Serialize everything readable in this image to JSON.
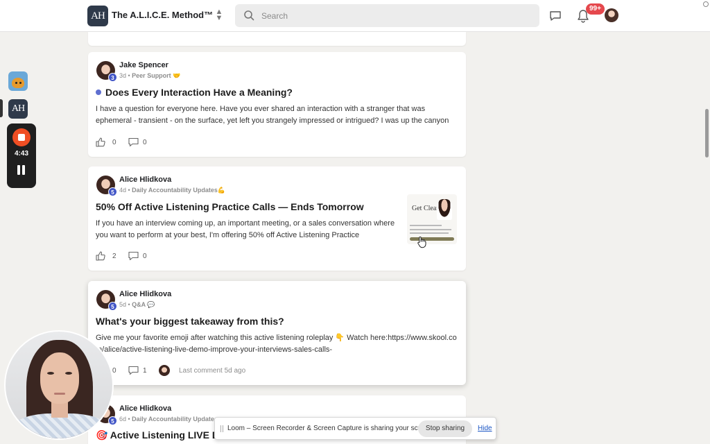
{
  "header": {
    "logo_text": "AH",
    "group_title": "The A.L.I.C.E. Method™",
    "search_placeholder": "Search",
    "notification_count": "99+"
  },
  "rail": {
    "app2_text": "AH",
    "recorder_time": "4:43"
  },
  "posts": [
    {
      "author": "Jake Spencer",
      "level": "3",
      "age": "3d",
      "category": "Peer Support 🤝",
      "title": "Does Every Interaction Have a Meaning?",
      "body": "I have a question for everyone here. Have you ever shared an interaction with a stranger that was ephemeral - transient - on the surface, yet left you strangely impressed or intrigued? I was up the canyon",
      "likes": "0",
      "comments": "0"
    },
    {
      "author": "Alice Hlidkova",
      "level": "5",
      "age": "4d",
      "category": "Daily Accountability Updates💪",
      "title": "50% Off Active Listening Practice Calls — Ends Tomorrow",
      "body": "If you have an interview coming up, an important meeting, or a sales conversation where you want to perform at your best, I'm offering 50% off Active Listening Practice",
      "likes": "2",
      "comments": "0",
      "thumb_headline": "Get Clear"
    },
    {
      "author": "Alice Hlidkova",
      "level": "5",
      "age": "5d",
      "category": "Q&A 💬",
      "title": "What's your biggest takeaway from this?",
      "body": "Give me your favorite emoji after watching this active listening roleplay 👇 Watch here:https://www.skool.com/alice/active-listening-live-demo-improve-your-interviews-sales-calls-",
      "likes": "0",
      "comments": "1",
      "last_comment": "Last comment 5d ago"
    },
    {
      "author": "Alice Hlidkova",
      "level": "5",
      "age": "6d",
      "category": "Daily Accountability Updates",
      "title": "🎯 Active Listening LIVE De"
    }
  ],
  "loom": {
    "message": "Loom – Screen Recorder & Screen Capture is sharing your screen.",
    "stop_label": "Stop sharing",
    "hide_label": "Hide"
  },
  "colors": {
    "level_badge": "#4256c7",
    "notification_badge": "#e5484d",
    "recorder_stop": "#f04e23",
    "unread_dot": "#5f6fd0"
  }
}
